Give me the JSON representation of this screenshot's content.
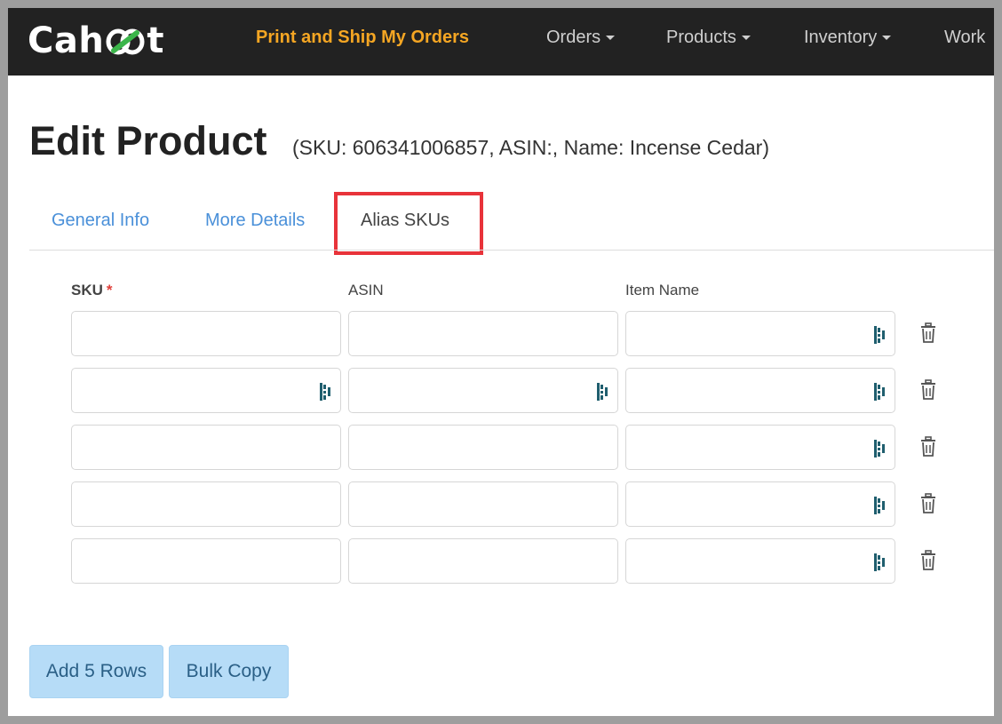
{
  "navbar": {
    "logo_text_start": "Cah",
    "logo_text_end": "t",
    "items": [
      {
        "label": "Print and Ship My Orders",
        "highlight": true,
        "dropdown": false
      },
      {
        "label": "Orders",
        "dropdown": true
      },
      {
        "label": "Products",
        "dropdown": true
      },
      {
        "label": "Inventory",
        "dropdown": true
      },
      {
        "label": "Work",
        "dropdown": false
      }
    ]
  },
  "page": {
    "title": "Edit Product",
    "subtitle": "(SKU: 606341006857, ASIN:, Name: Incense Cedar)"
  },
  "tabs": [
    {
      "label": "General Info",
      "active": false
    },
    {
      "label": "More Details",
      "active": false
    },
    {
      "label": "Alias SKUs",
      "active": true
    }
  ],
  "alias_table": {
    "columns": [
      {
        "label": "SKU",
        "required_marker": "*"
      },
      {
        "label": "ASIN"
      },
      {
        "label": "Item Name"
      }
    ],
    "rows": [
      {
        "sku": "",
        "asin": "",
        "item_name": ""
      },
      {
        "sku": "",
        "asin": "",
        "item_name": ""
      },
      {
        "sku": "",
        "asin": "",
        "item_name": ""
      },
      {
        "sku": "",
        "asin": "",
        "item_name": ""
      },
      {
        "sku": "",
        "asin": "",
        "item_name": ""
      }
    ]
  },
  "buttons": {
    "add_rows": "Add 5 Rows",
    "bulk_copy": "Bulk Copy"
  },
  "icons": {
    "field_helper": "keeper-icon",
    "delete": "trash-icon",
    "dropdown": "caret-down-icon"
  },
  "colors": {
    "navbar_bg": "#222222",
    "nav_highlight": "#f5a623",
    "tab_link": "#4a90d9",
    "highlight_box": "#e8333a",
    "button_bg": "#b6dcf7",
    "icon_teal": "#1f5e6e"
  }
}
